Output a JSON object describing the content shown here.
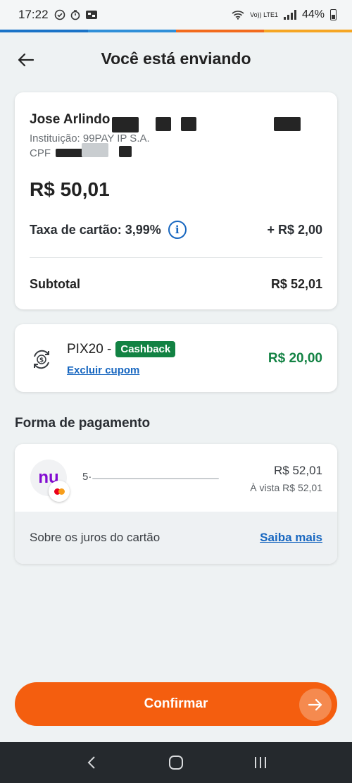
{
  "status_bar": {
    "time": "17:22",
    "network_label": "Vo)) LTE1",
    "battery": "44%"
  },
  "header": {
    "title": "Você está enviando",
    "back_icon": "arrow-left-icon"
  },
  "recipient": {
    "name": "Jose Arlindo",
    "institution": "Instituição: 99PAY IP S.A.",
    "cpf_label": "CPF",
    "amount": "R$ 50,01",
    "fee_label": "Taxa de cartão: 3,99%",
    "fee_value": "+ R$ 2,00",
    "subtotal_label": "Subtotal",
    "subtotal_value": "R$ 52,01"
  },
  "coupon": {
    "code": "PIX20 -",
    "badge": "Cashback",
    "remove_label": "Excluir cupom",
    "value": "R$ 20,00"
  },
  "payment": {
    "section_title": "Forma de pagamento",
    "card_logo_text": "nu",
    "card_desc": "5·",
    "value": "R$ 52,01",
    "sub_value": "À vista R$ 52,01",
    "interest_text": "Sobre os juros do cartão",
    "learn_more": "Saiba mais"
  },
  "confirm": {
    "label": "Confirmar"
  },
  "colors": {
    "accent_orange": "#f45e0f",
    "link_blue": "#1867c0",
    "green": "#128243",
    "nubank_purple": "#820ad1"
  }
}
